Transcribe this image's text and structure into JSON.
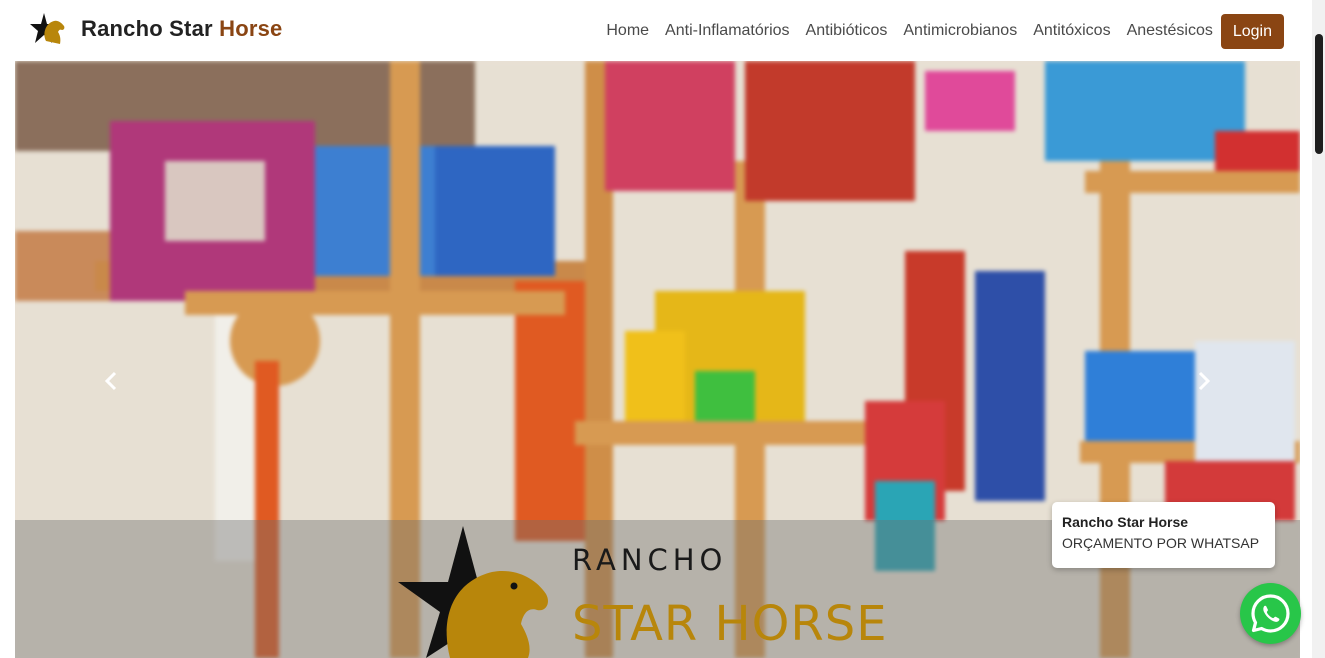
{
  "navbar": {
    "brand_main": "Rancho Star",
    "brand_accent": "Horse",
    "links": [
      "Home",
      "Anti-Inflamatórios",
      "Antibióticos",
      "Antimicrobianos",
      "Antitóxicos",
      "Anestésicos"
    ],
    "login_label": "Login"
  },
  "carousel": {
    "logo_line1": "RANCHO",
    "logo_line2": "STAR HORSE"
  },
  "whatsapp": {
    "title": "Rancho Star Horse",
    "subtitle": "ORÇAMENTO POR WHATSAP"
  },
  "colors": {
    "brand_brown": "#8a4513",
    "logo_gold": "#b8860b",
    "whatsapp_green": "#28c649"
  }
}
